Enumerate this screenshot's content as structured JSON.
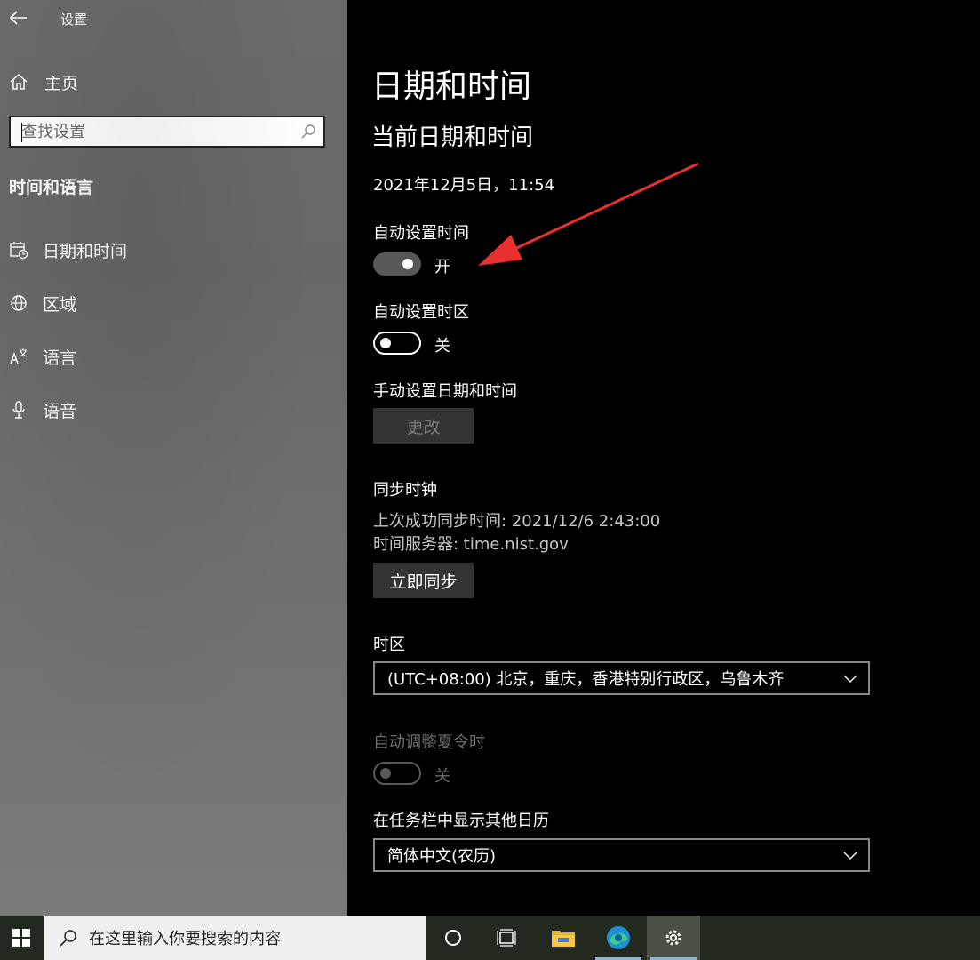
{
  "window": {
    "title": "设置"
  },
  "sidebar": {
    "home_label": "主页",
    "search_placeholder": "查找设置",
    "section_title": "时间和语言",
    "items": [
      {
        "label": "日期和时间",
        "icon": "calendar-clock-icon"
      },
      {
        "label": "区域",
        "icon": "globe-icon"
      },
      {
        "label": "语言",
        "icon": "language-icon"
      },
      {
        "label": "语音",
        "icon": "microphone-icon"
      }
    ]
  },
  "main": {
    "page_title": "日期和时间",
    "current_heading": "当前日期和时间",
    "current_datetime": "2021年12月5日，11:54",
    "auto_time": {
      "label": "自动设置时间",
      "state": "开",
      "on": true
    },
    "auto_timezone": {
      "label": "自动设置时区",
      "state": "关",
      "on": false
    },
    "manual": {
      "label": "手动设置日期和时间",
      "button": "更改"
    },
    "sync": {
      "label": "同步时钟",
      "last_sync": "上次成功同步时间: 2021/12/6 2:43:00",
      "server": "时间服务器: time.nist.gov",
      "button": "立即同步"
    },
    "timezone": {
      "label": "时区",
      "value": "(UTC+08:00) 北京，重庆，香港特别行政区，乌鲁木齐"
    },
    "dst": {
      "label": "自动调整夏令时",
      "state": "关",
      "on": false,
      "disabled": true
    },
    "calendar": {
      "label": "在任务栏中显示其他日历",
      "value": "简体中文(农历)"
    }
  },
  "taskbar": {
    "search_placeholder": "在这里输入你要搜索的内容",
    "icons": [
      "windows-start-icon",
      "cortana-icon",
      "task-view-icon",
      "file-explorer-icon",
      "edge-icon",
      "settings-gear-icon"
    ]
  },
  "colors": {
    "annotation_arrow": "#e8312f",
    "taskbar_underline": "#8ab4e8"
  }
}
